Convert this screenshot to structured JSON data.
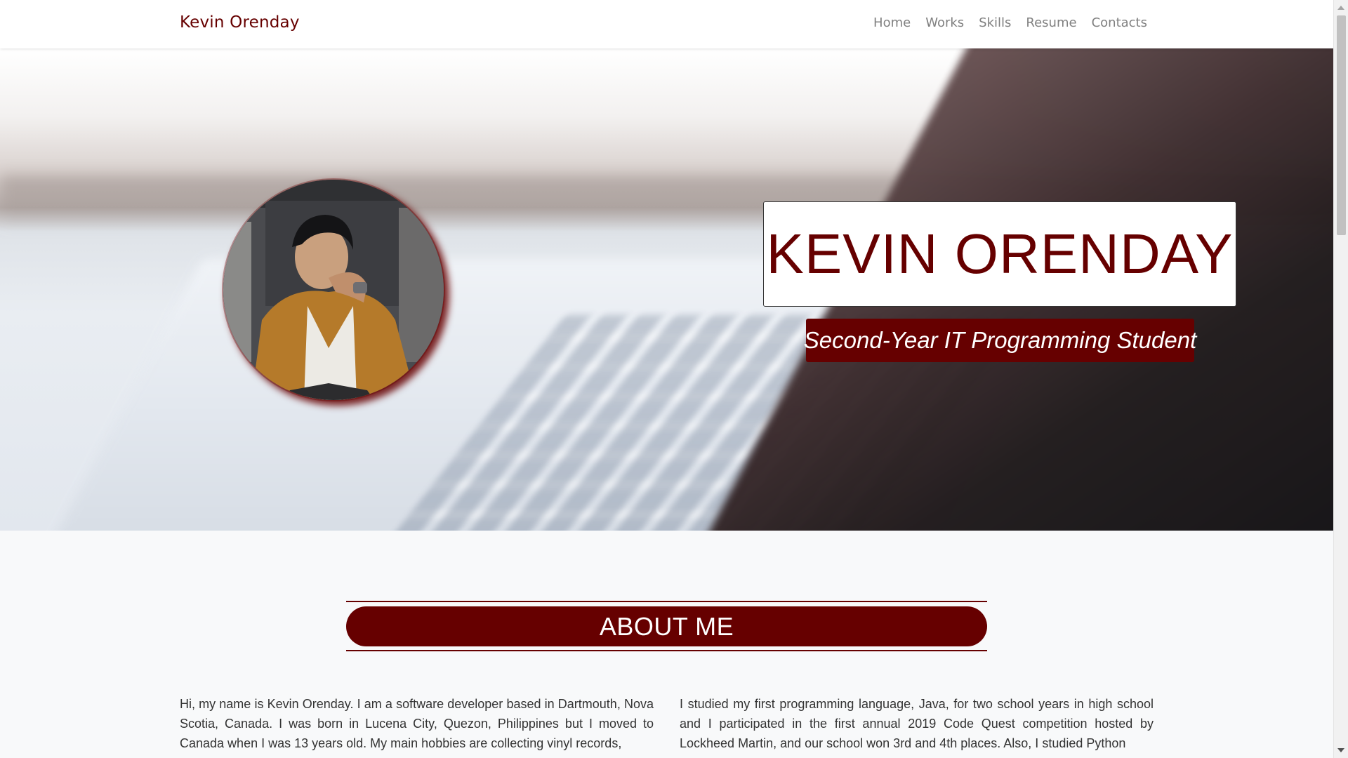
{
  "nav": {
    "brand": "Kevin Orenday",
    "links": [
      "Home",
      "Works",
      "Skills",
      "Resume",
      "Contacts"
    ]
  },
  "hero": {
    "name": "KEVIN ORENDAY",
    "subtitle": "Second-Year IT Programming Student",
    "avatar_alt": "profile photo"
  },
  "about": {
    "heading": "ABOUT ME",
    "left_paragraph": "Hi, my name is Kevin Orenday. I am a software developer based in Dartmouth, Nova Scotia, Canada. I was born in Lucena City, Quezon, Philippines but I moved to Canada when I was 13 years old. My main hobbies are collecting vinyl records,",
    "right_paragraph": "I studied my first programming language, Java, for two school years in high school and I participated in the first annual 2019 Code Quest competition hosted by Lockheed Martin, and our school won 3rd and 4th places. Also, I studied Python"
  },
  "colors": {
    "accent": "#660000",
    "nav_link": "#808080",
    "section_bg": "#f8f9fa"
  },
  "icons": {
    "scroll_up": "chevron-up-icon",
    "scroll_down": "chevron-down-icon"
  }
}
